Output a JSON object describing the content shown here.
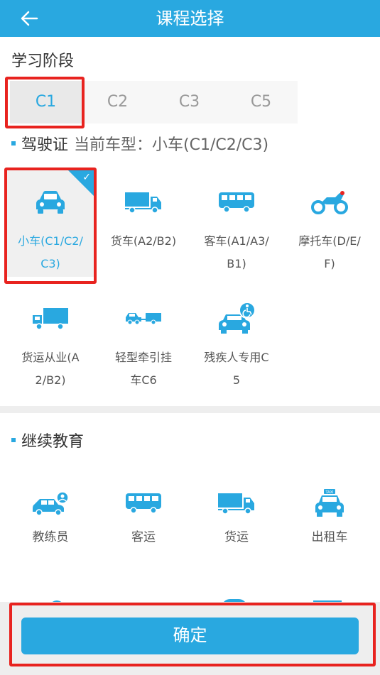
{
  "header": {
    "title": "课程选择",
    "back_icon": "arrow-left-icon"
  },
  "stage": {
    "title": "学习阶段",
    "tabs": [
      {
        "label": "C1",
        "active": true
      },
      {
        "label": "C2",
        "active": false
      },
      {
        "label": "C3",
        "active": false
      },
      {
        "label": "C5",
        "active": false
      }
    ]
  },
  "license": {
    "title": "驾驶证",
    "current": "当前车型：小车(C1/C2/C3)",
    "items": [
      {
        "label": "小车(C1/C2/C3)",
        "icon": "car-icon",
        "selected": true
      },
      {
        "label": "货车(A2/B2)",
        "icon": "truck-icon",
        "selected": false
      },
      {
        "label": "客车(A1/A3/B1)",
        "icon": "bus-icon",
        "selected": false
      },
      {
        "label": "摩托车(D/E/F)",
        "icon": "motorcycle-icon",
        "selected": false
      },
      {
        "label": "货运从业(A2/B2)",
        "icon": "freight-truck-icon",
        "selected": false
      },
      {
        "label": "轻型牵引挂车C6",
        "icon": "trailer-icon",
        "selected": false
      },
      {
        "label": "残疾人专用C5",
        "icon": "accessible-car-icon",
        "selected": false
      }
    ]
  },
  "continuing": {
    "title": "继续教育",
    "items": [
      {
        "label": "教练员",
        "icon": "coach-car-icon"
      },
      {
        "label": "客运",
        "icon": "bus-icon"
      },
      {
        "label": "货运",
        "icon": "truck-icon"
      },
      {
        "label": "出租车",
        "icon": "taxi-icon"
      }
    ]
  },
  "footer": {
    "confirm_label": "确定"
  },
  "colors": {
    "accent": "#29a8e0",
    "highlight": "#e8231f",
    "background": "#ffffff"
  }
}
